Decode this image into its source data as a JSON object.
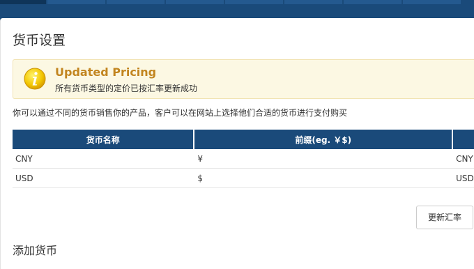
{
  "page": {
    "title": "货币设置",
    "description": "你可以通过不同的货币销售你的产品，客户可以在网站上选择他们合适的货币进行支付购买"
  },
  "alert": {
    "title": "Updated Pricing",
    "message": "所有货币类型的定价已按汇率更新成功",
    "icon": "info-icon",
    "color": "#c2851f"
  },
  "table": {
    "headers": [
      "货币名称",
      "前缀(eg. ￥$)",
      ""
    ],
    "rows": [
      [
        "CNY",
        "¥",
        "CNY"
      ],
      [
        "USD",
        "$",
        "USD"
      ]
    ]
  },
  "buttons": {
    "update_rates": "更新汇率"
  },
  "section": {
    "add_currency": "添加货币"
  },
  "colors": {
    "header_blue": "#1a4a7a",
    "alert_bg": "#fcf8e3"
  }
}
